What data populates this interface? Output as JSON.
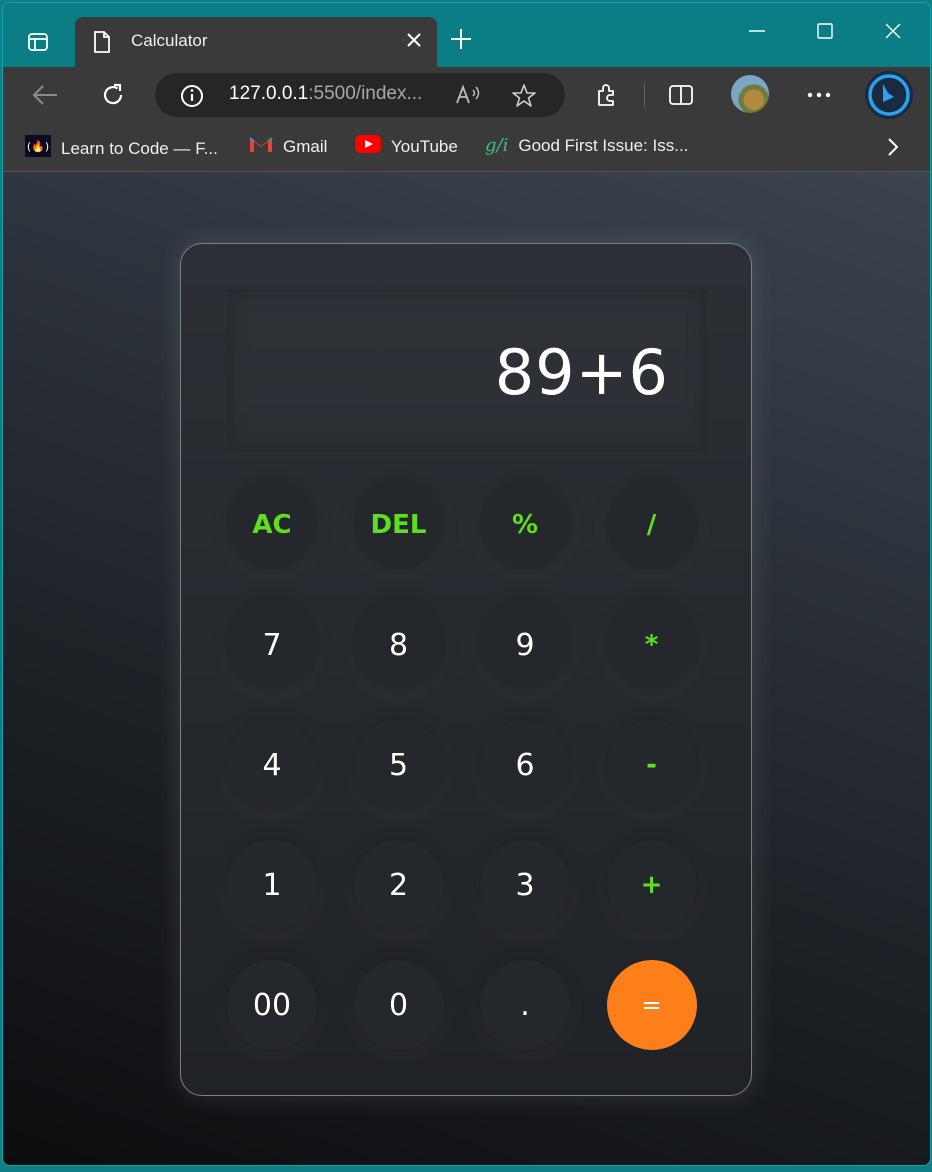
{
  "browser": {
    "tab": {
      "title": "Calculator",
      "icon": "page-icon"
    },
    "address": {
      "host": "127.0.0.1",
      "rest": ":5500/index..."
    },
    "bookmarks": [
      {
        "label": "Learn to Code — F...",
        "icon": "freecodecamp-icon"
      },
      {
        "label": "Gmail",
        "icon": "gmail-icon"
      },
      {
        "label": "YouTube",
        "icon": "youtube-icon"
      },
      {
        "label": "Good First Issue: Iss...",
        "icon": "gfi-icon"
      }
    ]
  },
  "calculator": {
    "display": "89+6",
    "keys": [
      [
        "AC",
        "DEL",
        "%",
        "/"
      ],
      [
        "7",
        "8",
        "9",
        "*"
      ],
      [
        "4",
        "5",
        "6",
        "-"
      ],
      [
        "1",
        "2",
        "3",
        "+"
      ],
      [
        "00",
        "0",
        ".",
        "="
      ]
    ]
  },
  "colors": {
    "accent_green": "#5ee01e",
    "equals_orange": "#fd7f1a",
    "frame_teal": "#0b7d84"
  }
}
